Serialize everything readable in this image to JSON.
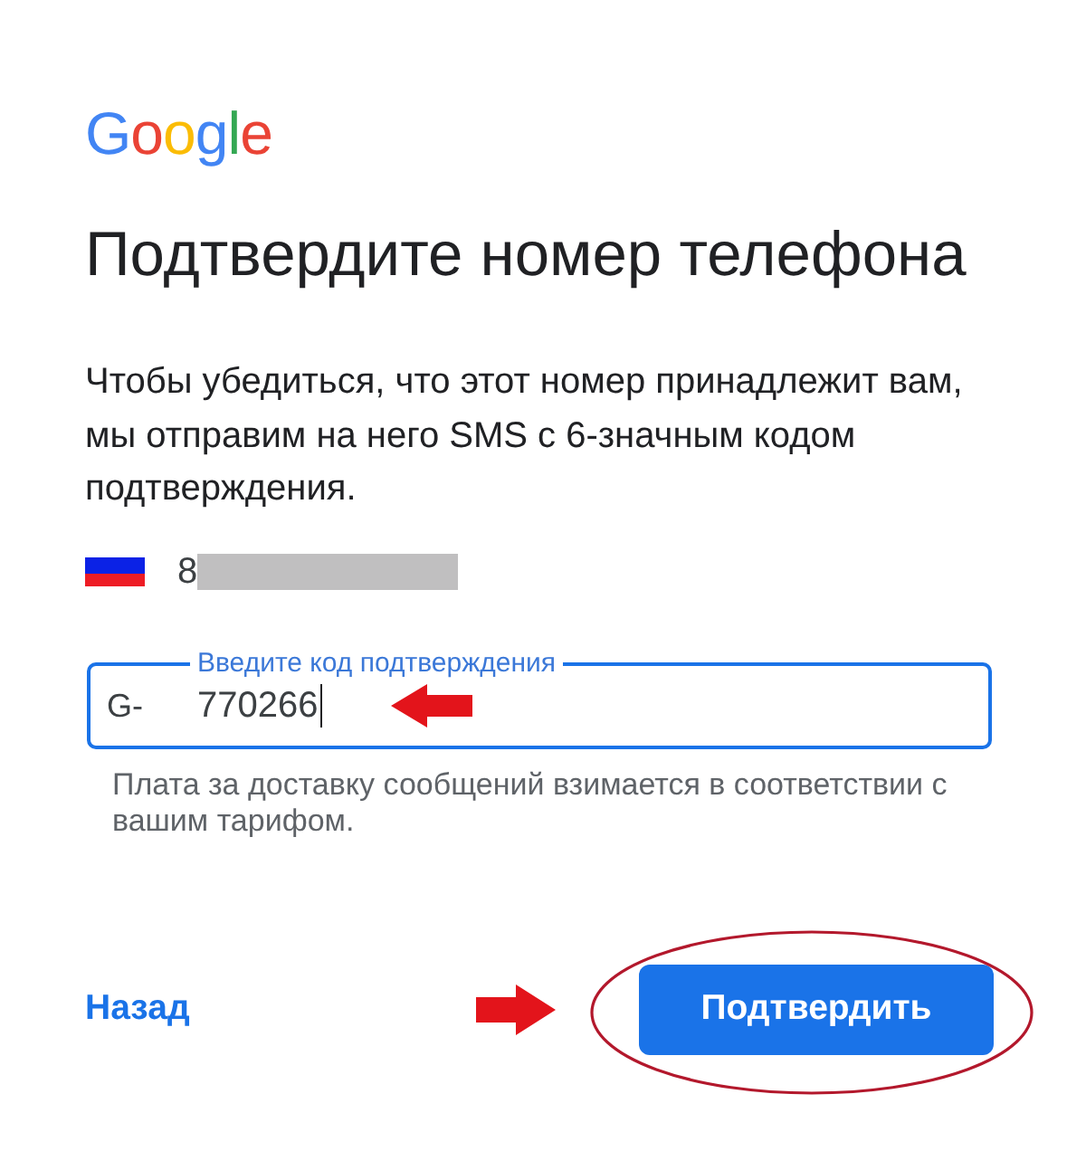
{
  "logo": "Google",
  "title": "Подтвердите номер телефона",
  "description": "Чтобы убедиться, что этот номер принадлежит вам, мы отправим на него SMS с 6-значным кодом подтверждения.",
  "phone": {
    "number": "8",
    "redacted": true
  },
  "code_field": {
    "label": "Введите код подтверждения",
    "prefix": "G-",
    "value": "770266",
    "focused": true
  },
  "hint": "Плата за доставку сообщений взимается в соответствии с вашим тарифом.",
  "back_link": "Назад",
  "confirm_button": "Подтвердить"
}
